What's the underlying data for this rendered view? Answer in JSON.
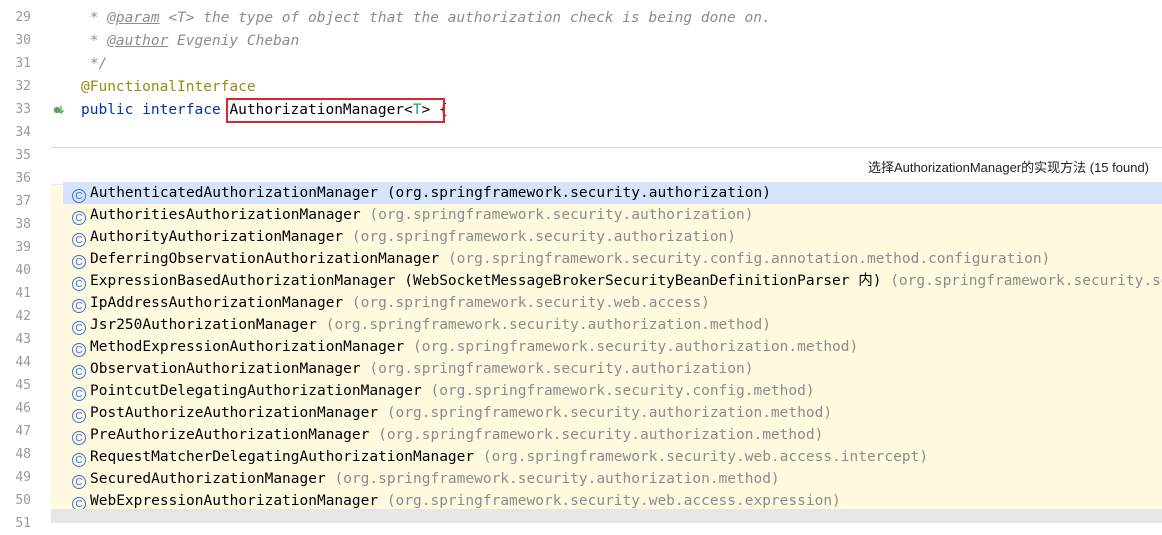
{
  "gutter": {
    "lines": [
      "29",
      "30",
      "31",
      "32",
      "33",
      "34",
      "35",
      "36",
      "37",
      "38",
      "39",
      "40",
      "41",
      "42",
      "43",
      "44",
      "45",
      "46",
      "47",
      "48",
      "49",
      "50",
      "51"
    ]
  },
  "code": {
    "line29": {
      "prefix": " * ",
      "tag": "@param",
      "rest": " <T> the type of object that the authorization check is being done on."
    },
    "line30": {
      "prefix": " * ",
      "tag": "@author",
      "rest": " Evgeniy Cheban"
    },
    "line31": " */",
    "line32": "@FunctionalInterface",
    "line33": {
      "kw1": "public",
      "kw2": "interface",
      "name": "AuthorizationManager",
      "lt": "<",
      "tp": "T",
      "gt": ">",
      "brace": " {"
    }
  },
  "popup": {
    "title": "选择AuthorizationManager的实现方法 (15 found)",
    "icon_glyph": "C",
    "items": [
      {
        "name": "AuthenticatedAuthorizationManager",
        "pkg": "(org.springframework.security.authorization)"
      },
      {
        "name": "AuthoritiesAuthorizationManager",
        "pkg": "(org.springframework.security.authorization)"
      },
      {
        "name": "AuthorityAuthorizationManager",
        "pkg": "(org.springframework.security.authorization)"
      },
      {
        "name": "DeferringObservationAuthorizationManager",
        "pkg": "(org.springframework.security.config.annotation.method.configuration)"
      },
      {
        "name": "ExpressionBasedAuthorizationManager (WebSocketMessageBrokerSecurityBeanDefinitionParser 内)",
        "pkg": "(org.springframework.security.securit"
      },
      {
        "name": "IpAddressAuthorizationManager",
        "pkg": "(org.springframework.security.web.access)"
      },
      {
        "name": "Jsr250AuthorizationManager",
        "pkg": "(org.springframework.security.authorization.method)"
      },
      {
        "name": "MethodExpressionAuthorizationManager",
        "pkg": "(org.springframework.security.authorization.method)"
      },
      {
        "name": "ObservationAuthorizationManager",
        "pkg": "(org.springframework.security.authorization)"
      },
      {
        "name": "PointcutDelegatingAuthorizationManager",
        "pkg": "(org.springframework.security.config.method)"
      },
      {
        "name": "PostAuthorizeAuthorizationManager",
        "pkg": "(org.springframework.security.authorization.method)"
      },
      {
        "name": "PreAuthorizeAuthorizationManager",
        "pkg": "(org.springframework.security.authorization.method)"
      },
      {
        "name": "RequestMatcherDelegatingAuthorizationManager",
        "pkg": "(org.springframework.security.web.access.intercept)"
      },
      {
        "name": "SecuredAuthorizationManager",
        "pkg": "(org.springframework.security.authorization.method)"
      },
      {
        "name": "WebExpressionAuthorizationManager",
        "pkg": "(org.springframework.security.web.access.expression)"
      }
    ]
  },
  "colors": {
    "keyword": "#0033b3",
    "annotation": "#9e880d",
    "comment": "#8c8c8c",
    "highlight_box": "#d9262f",
    "selected_row": "#d5e4fb",
    "popup_bg": "#fffadf",
    "class_icon": "#3574f0"
  }
}
